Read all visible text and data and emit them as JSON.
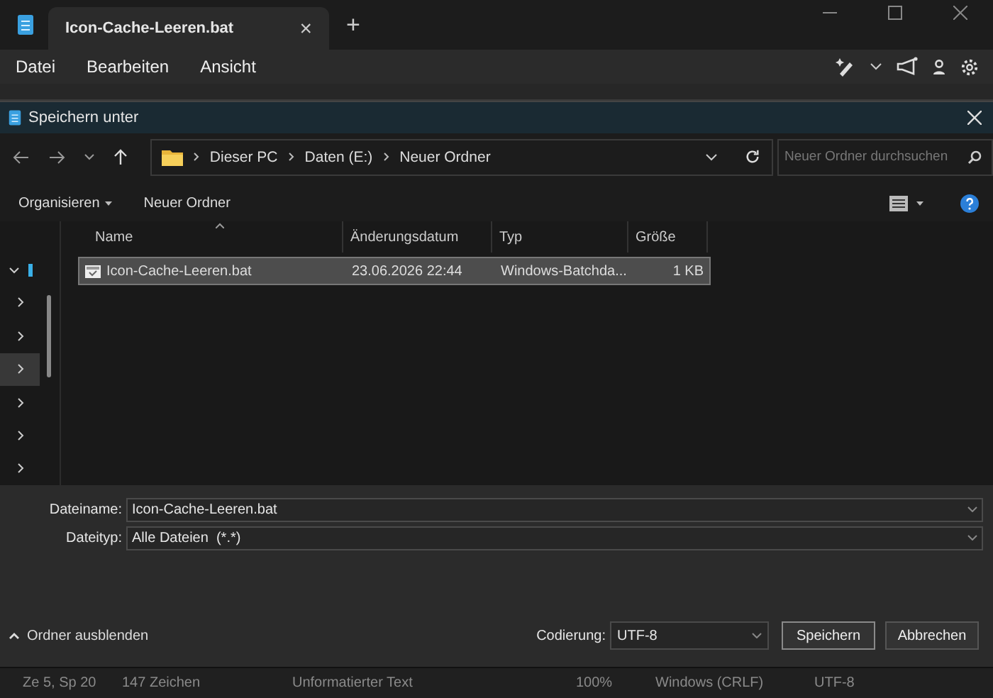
{
  "editor": {
    "tab": {
      "title": "Icon-Cache-Leeren.bat",
      "close": "×"
    },
    "new_tab": "+",
    "menu": [
      {
        "label": "Datei"
      },
      {
        "label": "Bearbeiten"
      },
      {
        "label": "Ansicht"
      }
    ]
  },
  "dialog": {
    "title": "Speichern unter",
    "breadcrumb": [
      "Dieser PC",
      "Daten (E:)",
      "Neuer Ordner"
    ],
    "search": {
      "placeholder": "Neuer Ordner durchsuchen"
    },
    "toolbar": [
      {
        "label": "Organisieren",
        "dropdown": true
      },
      {
        "label": "Neuer Ordner",
        "dropdown": false
      }
    ],
    "nav_items": [
      {
        "expanded": true,
        "selected": false
      },
      {
        "expanded": false,
        "selected": false
      },
      {
        "expanded": false,
        "selected": false
      },
      {
        "expanded": false,
        "selected": true
      },
      {
        "expanded": false,
        "selected": false
      },
      {
        "expanded": false,
        "selected": false
      },
      {
        "expanded": false,
        "selected": false
      }
    ],
    "columns": [
      "Name",
      "Änderungsdatum",
      "Typ",
      "Größe"
    ],
    "rows": [
      {
        "name": "Icon-Cache-Leeren.bat",
        "date": "23.06.2026 22:44",
        "type": "Windows-Batchda...",
        "size": "1 KB",
        "selected": true
      }
    ],
    "filename": {
      "label": "Dateiname:",
      "value": "Icon-Cache-Leeren.bat"
    },
    "filetype": {
      "label": "Dateityp:",
      "value": "Alle Dateien  (*.*)"
    },
    "hide_folders": "Ordner ausblenden",
    "encoding": {
      "label": "Codierung:",
      "value": "UTF-8"
    },
    "buttons": [
      "Speichern",
      "Abbrechen"
    ]
  },
  "status_bar": [
    "Ze 5, Sp 20",
    "147 Zeichen",
    "Unformatierter Text",
    "100%",
    "Windows (CRLF)",
    "UTF-8"
  ]
}
